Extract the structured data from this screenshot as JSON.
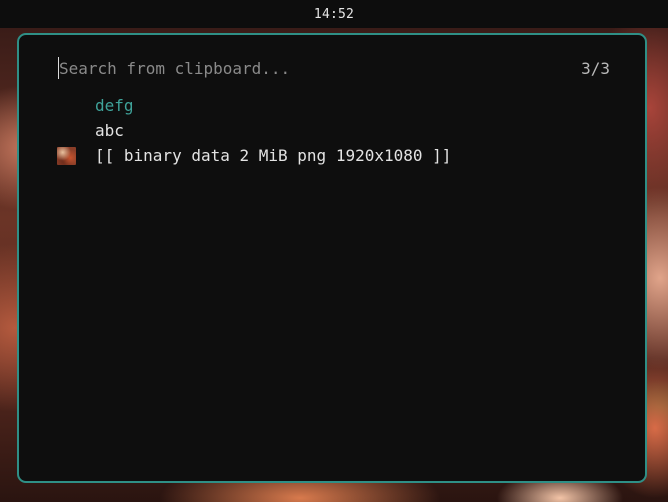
{
  "topbar": {
    "clock": "14:52"
  },
  "launcher": {
    "search": {
      "placeholder": "Search from clipboard...",
      "value": ""
    },
    "counter": "3/3",
    "entries": [
      {
        "text": "defg",
        "selected": true,
        "has_thumbnail": false
      },
      {
        "text": "abc",
        "selected": false,
        "has_thumbnail": false
      },
      {
        "text": "[[ binary data 2 MiB png 1920x1080 ]]",
        "selected": false,
        "has_thumbnail": true
      }
    ]
  },
  "colors": {
    "accent": "#2f8f86",
    "selected_text": "#3fa39a",
    "panel_background": "#0e0e0e",
    "text": "#e3e3e3",
    "placeholder": "#8a8a8a"
  },
  "icons": {
    "image_entry": "image-thumbnail-icon"
  }
}
